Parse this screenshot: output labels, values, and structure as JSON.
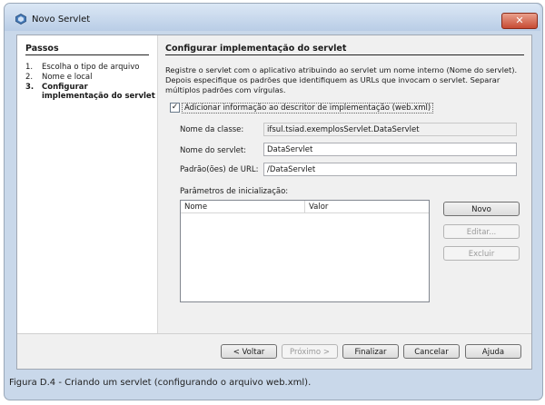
{
  "window": {
    "title": "Novo Servlet",
    "close_glyph": "✕"
  },
  "steps": {
    "heading": "Passos",
    "items": [
      {
        "num": "1.",
        "label": "Escolha o tipo de arquivo"
      },
      {
        "num": "2.",
        "label": "Nome e local"
      },
      {
        "num": "3.",
        "label": "Configurar",
        "label2": "implementação do servlet"
      }
    ]
  },
  "main": {
    "heading": "Configurar implementação do servlet",
    "description": "Registre o servlet com o aplicativo atribuindo ao servlet um nome interno (Nome do servlet). Depois especifique os padrões que identifiquem as URLs que invocam o servlet. Separar múltiplos padrões com vírgulas.",
    "checkbox": {
      "label": "Adicionar informação ao descritor de implementação (web.xml)",
      "checked": true,
      "glyph": "✓"
    },
    "fields": {
      "class_name": {
        "label": "Nome da classe:",
        "value": "ifsul.tsiad.exemplosServlet.DataServlet"
      },
      "servlet_name": {
        "label": "Nome do servlet:",
        "value": "DataServlet"
      },
      "url_pattern": {
        "label": "Padrão(ões) de URL:",
        "value": "/DataServlet"
      }
    },
    "init_params": {
      "label": "Parâmetros de inicialização:",
      "columns": [
        "Nome",
        "Valor"
      ],
      "rows": []
    },
    "param_buttons": {
      "new": "Novo",
      "edit": "Editar...",
      "delete": "Excluir"
    }
  },
  "footer": {
    "back": "< Voltar",
    "next": "Próximo >",
    "finish": "Finalizar",
    "cancel": "Cancelar",
    "help": "Ajuda"
  },
  "caption": "Figura D.4 - Criando um servlet (configurando o arquivo web.xml)."
}
